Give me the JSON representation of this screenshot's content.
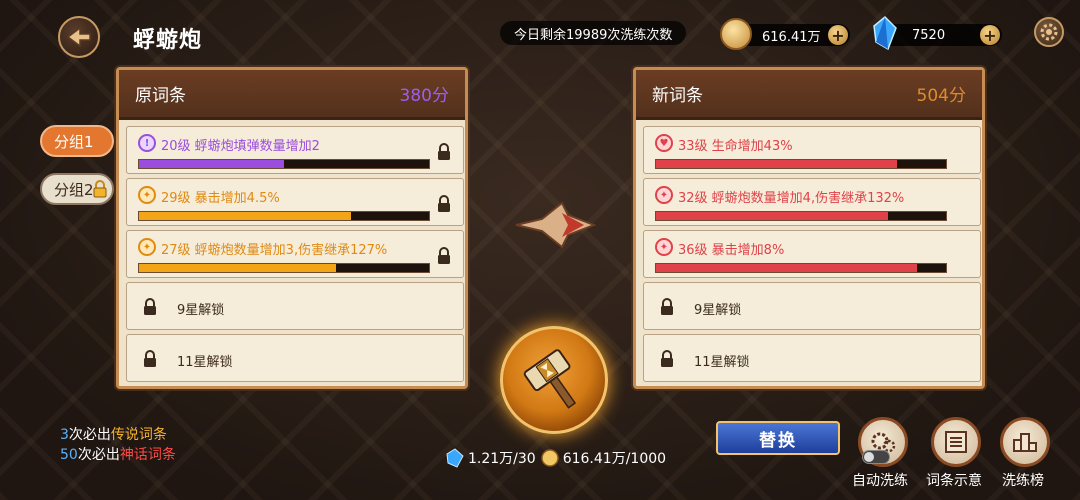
{
  "header": {
    "title": "蜉蝣炮",
    "remaining": "今日剩余19989次洗练次数",
    "coins": "616.41万",
    "gems": "7520",
    "plus": "+"
  },
  "groups": [
    {
      "label": "分组1",
      "active": true
    },
    {
      "label": "分组2",
      "locked": true
    }
  ],
  "left_panel": {
    "title": "原词条",
    "score": "380分",
    "score_color": "#a05cf0",
    "rows": [
      {
        "text": "20级 蜉蝣炮填弹数量增加2",
        "color": "#9b4de0",
        "bar_color": "#9b4de0",
        "progress": 0.5,
        "icon": "purple-skill-icon"
      },
      {
        "text": "29级 暴击增加4.5%",
        "color": "#e08a12",
        "bar_color": "#f2a516",
        "progress": 0.73,
        "icon": "orange-skill-icon"
      },
      {
        "text": "27级 蜉蝣炮数量增加3,伤害继承127%",
        "color": "#e08a12",
        "bar_color": "#f2a516",
        "progress": 0.68,
        "icon": "orange-skill-icon"
      }
    ],
    "locked": [
      "9星解锁",
      "11星解锁"
    ]
  },
  "right_panel": {
    "title": "新词条",
    "score": "504分",
    "score_color": "#e08a2a",
    "rows": [
      {
        "text": "33级 生命增加43%",
        "color": "#e0424a",
        "bar_color": "#e0424a",
        "progress": 0.83,
        "icon": "red-skill-icon"
      },
      {
        "text": "32级 蜉蝣炮数量增加4,伤害继承132%",
        "color": "#e0424a",
        "bar_color": "#e0424a",
        "progress": 0.8,
        "icon": "red-skill-icon"
      },
      {
        "text": "36级 暴击增加8%",
        "color": "#e0424a",
        "bar_color": "#e0424a",
        "progress": 0.9,
        "icon": "red-skill-icon"
      }
    ],
    "locked": [
      "9星解锁",
      "11星解锁"
    ]
  },
  "tips": {
    "line1_num": "3",
    "line1_mid": "次必出",
    "line1_tag": "传说词条",
    "line2_num": "50",
    "line2_mid": "次必出",
    "line2_tag": "神话词条"
  },
  "cost": {
    "crystal": "1.21万/30",
    "coin": "616.41万/1000"
  },
  "buttons": {
    "replace": "替换",
    "auto": "自动洗练",
    "hint": "词条示意",
    "rank": "洗练榜"
  }
}
